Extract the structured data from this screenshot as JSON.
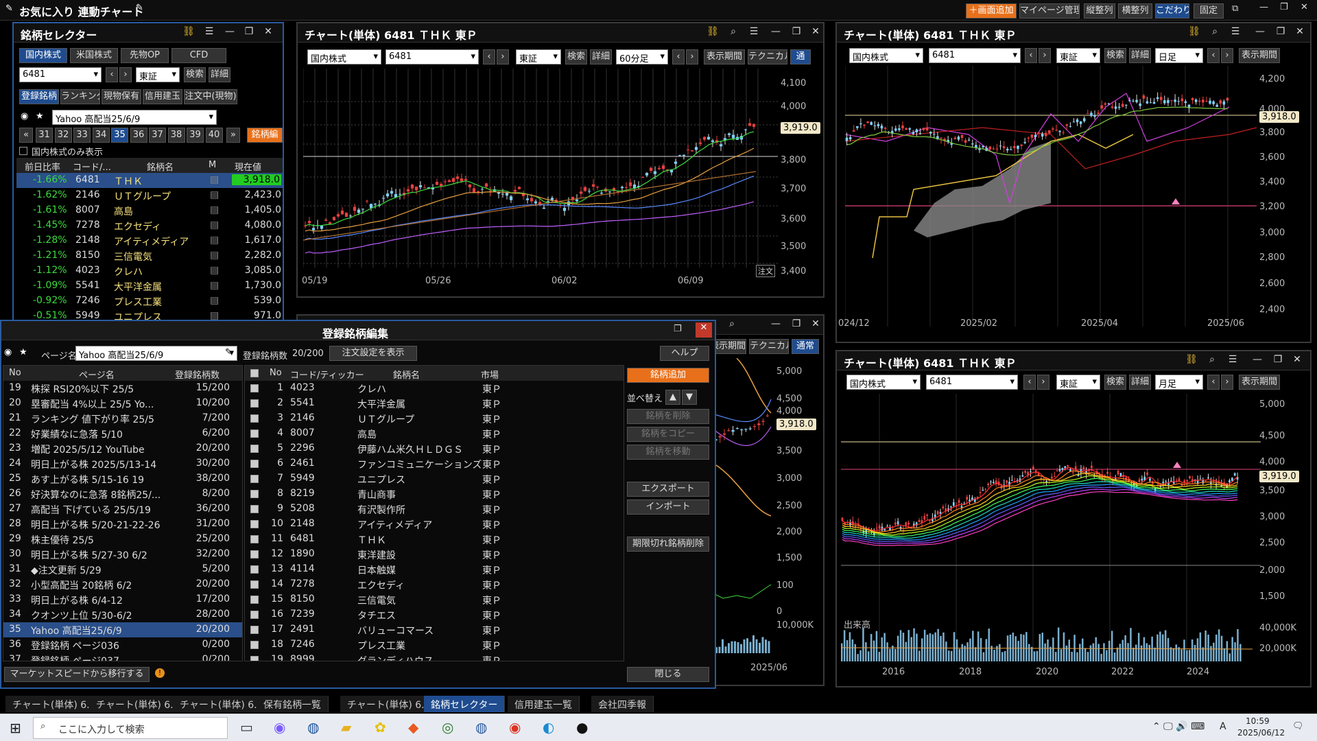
{
  "app": {
    "title": "お気に入り 連動チャート",
    "toolbar": [
      "＋画面追加",
      "マイページ管理",
      "縦整列",
      "横整列",
      "こだわり",
      "固定"
    ]
  },
  "selector": {
    "title": "銘柄セレクター",
    "tabs": [
      "国内株式",
      "米国株式",
      "先物OP",
      "CFD"
    ],
    "code": "6481",
    "market": "東証",
    "search": "検索",
    "detail": "詳細",
    "subtabs": [
      "登録銘柄",
      "ランキング",
      "現物保有",
      "信用建玉",
      "注文中(現物)"
    ],
    "page_select": "Yahoo 高配当25/6/9",
    "pages": [
      "31",
      "32",
      "33",
      "34",
      "35",
      "36",
      "37",
      "38",
      "39",
      "40"
    ],
    "edit_btn": "銘柄編",
    "domestic_only": "国内株式のみ表示",
    "headers": [
      "前日比率",
      "コード/...",
      "銘柄名",
      "M",
      "現在値"
    ],
    "rows": [
      [
        "-1.66%",
        "6481",
        "ＴＨＫ",
        "3,918.0"
      ],
      [
        "-1.62%",
        "2146",
        "ＵＴグループ",
        "2,423.0"
      ],
      [
        "-1.61%",
        "8007",
        "高島",
        "1,405.0"
      ],
      [
        "-1.45%",
        "7278",
        "エクセディ",
        "4,080.0"
      ],
      [
        "-1.28%",
        "2148",
        "アイティメディア",
        "1,617.0"
      ],
      [
        "-1.21%",
        "8150",
        "三信電気",
        "2,282.0"
      ],
      [
        "-1.12%",
        "4023",
        "クレハ",
        "3,085.0"
      ],
      [
        "-1.09%",
        "5541",
        "大平洋金属",
        "1,730.0"
      ],
      [
        "-0.92%",
        "7246",
        "プレス工業",
        "539.0"
      ],
      [
        "-0.51%",
        "5949",
        "ユニプレス",
        "971.0"
      ]
    ]
  },
  "chart1": {
    "title": "チャート(単体) 6481 ＴＨＫ 東Ｐ",
    "market_type": "国内株式",
    "code": "6481",
    "exchange": "東証",
    "search": "検索",
    "detail": "詳細",
    "period": "60分足",
    "display": "表示期間",
    "tech": "テクニカル",
    "extra": "通",
    "y_ticks": [
      "4,100",
      "4,000",
      "3,919.0",
      "3,800",
      "3,700",
      "3,600",
      "3,500",
      "3,400"
    ],
    "x_ticks": [
      "05/19",
      "05/26",
      "06/02",
      "06/09"
    ],
    "order": "注文"
  },
  "chart2": {
    "title": "チャート(単体) 6481 ＴＨＫ 東Ｐ",
    "market_type": "国内株式",
    "code": "6481",
    "exchange": "東証",
    "search": "検索",
    "detail": "詳細",
    "period": "日足",
    "display": "表示期間",
    "y_ticks": [
      "4,200",
      "4,000",
      "3,918.0",
      "3,800",
      "3,600",
      "3,400",
      "3,200",
      "3,000",
      "2,800",
      "2,600",
      "2,400"
    ],
    "x_ticks": [
      "024/12",
      "2025/02",
      "2025/04",
      "2025/06"
    ]
  },
  "chart3": {
    "title": "チャート(単体) 6481 ＴＨＫ 東Ｐ",
    "market_type": "国内株式",
    "code": "6481",
    "exchange": "東証",
    "search": "検索",
    "detail": "詳細",
    "period": "月足",
    "display": "表示期間",
    "y_ticks": [
      "5,000",
      "4,500",
      "4,000",
      "3,919.0",
      "3,500",
      "3,000",
      "2,500",
      "2,000",
      "1,500"
    ],
    "vol_label": "出来高",
    "vol_ticks": [
      "40,000K",
      "20,000K"
    ],
    "x_ticks": [
      "2016",
      "2018",
      "2020",
      "2022",
      "2024"
    ]
  },
  "chart4": {
    "display": "表示期間",
    "tech": "テクニカル",
    "extra": "通常",
    "y_ticks": [
      "5,000",
      "4,500",
      "4,000",
      "3,918.0",
      "3,500",
      "3,000",
      "2,500",
      "2,000",
      "1,500",
      "100",
      "0",
      "10,000K"
    ],
    "x_tick": "2025/06"
  },
  "editor": {
    "title": "登録銘柄編集",
    "page_label": "ページ名",
    "page_name": "Yahoo 高配当25/6/9",
    "count_label": "登録銘柄数",
    "count": "20/200",
    "order_settings": "注文設定を表示",
    "help": "ヘルプ",
    "left_headers": [
      "No",
      "ページ名",
      "登録銘柄数"
    ],
    "pages": [
      [
        "19",
        "株探 RSI20%以下 25/5",
        "15/200"
      ],
      [
        "20",
        "塁審配当 4%以上 25/5 Yo...",
        "10/200"
      ],
      [
        "21",
        "ランキング 値下がり率 25/5",
        "7/200"
      ],
      [
        "22",
        "好業績なに急落 5/10",
        "6/200"
      ],
      [
        "23",
        "増配 2025/5/12 YouTube",
        "20/200"
      ],
      [
        "24",
        "明日上がる株 2025/5/13-14",
        "30/200"
      ],
      [
        "25",
        "あす上がる株 5/15-16 19",
        "38/200"
      ],
      [
        "26",
        "好決算なのに急落 8銘柄25/...",
        "8/200"
      ],
      [
        "27",
        "高配当 下げている 25/5/19",
        "36/200"
      ],
      [
        "28",
        "明日上がる株 5/20-21-22-26",
        "31/200"
      ],
      [
        "29",
        "株主優待 25/5",
        "25/200"
      ],
      [
        "30",
        "明日上がる株 5/27-30 6/2",
        "32/200"
      ],
      [
        "31",
        "◆注文更新 5/29",
        "5/200"
      ],
      [
        "32",
        "小型高配当 20銘柄 6/2",
        "20/200"
      ],
      [
        "33",
        "明日上がる株 6/4-12",
        "17/200"
      ],
      [
        "34",
        "クオンツ上位 5/30-6/2",
        "28/200"
      ],
      [
        "35",
        "Yahoo 高配当25/6/9",
        "20/200"
      ],
      [
        "36",
        "登録銘柄 ページ036",
        "0/200"
      ],
      [
        "37",
        "登録銘柄 ページ037",
        "0/200"
      ]
    ],
    "right_headers": [
      "No",
      "コード/ティッカー",
      "銘柄名",
      "市場"
    ],
    "stocks": [
      [
        "1",
        "4023",
        "クレハ",
        "東Ｐ"
      ],
      [
        "2",
        "5541",
        "大平洋金属",
        "東Ｐ"
      ],
      [
        "3",
        "2146",
        "ＵＴグループ",
        "東Ｐ"
      ],
      [
        "4",
        "8007",
        "高島",
        "東Ｐ"
      ],
      [
        "5",
        "2296",
        "伊藤ハム米久ＨＬＤＧＳ",
        "東Ｐ"
      ],
      [
        "6",
        "2461",
        "ファンコミュニケーションズ",
        "東Ｐ"
      ],
      [
        "7",
        "5949",
        "ユニプレス",
        "東Ｐ"
      ],
      [
        "8",
        "8219",
        "青山商事",
        "東Ｐ"
      ],
      [
        "9",
        "5208",
        "有沢製作所",
        "東Ｐ"
      ],
      [
        "10",
        "2148",
        "アイティメディア",
        "東Ｐ"
      ],
      [
        "11",
        "6481",
        "ＴＨＫ",
        "東Ｐ"
      ],
      [
        "12",
        "1890",
        "東洋建設",
        "東Ｐ"
      ],
      [
        "13",
        "4114",
        "日本触媒",
        "東Ｐ"
      ],
      [
        "14",
        "7278",
        "エクセディ",
        "東Ｐ"
      ],
      [
        "15",
        "8150",
        "三信電気",
        "東Ｐ"
      ],
      [
        "16",
        "7239",
        "タチエス",
        "東Ｐ"
      ],
      [
        "17",
        "2491",
        "バリューコマース",
        "東Ｐ"
      ],
      [
        "18",
        "7246",
        "プレス工業",
        "東Ｐ"
      ],
      [
        "19",
        "8999",
        "グランディハウス",
        "東Ｐ"
      ]
    ],
    "add": "銘柄追加",
    "sort": "並べ替え",
    "delete": "銘柄を削除",
    "copy": "銘柄をコピー",
    "move": "銘柄を移動",
    "export": "エクスポート",
    "import": "インポート",
    "expired": "期限切れ銘柄削除",
    "migrate": "マーケットスピードから移行する",
    "close": "閉じる"
  },
  "tabs": [
    "チャート(単体) 6...",
    "チャート(単体) 6...",
    "チャート(単体) 6...",
    "保有銘柄一覧",
    "チャート(単体) 6...",
    "銘柄セレクター",
    "信用建玉一覧",
    "会社四季報"
  ],
  "taskbar": {
    "search": "ここに入力して検索",
    "time": "10:59",
    "date": "2025/06/12",
    "ime": "A"
  },
  "colors": {
    "accent": "#1f4c8f",
    "down": "#3ddc3d",
    "orange": "#e8701a"
  }
}
